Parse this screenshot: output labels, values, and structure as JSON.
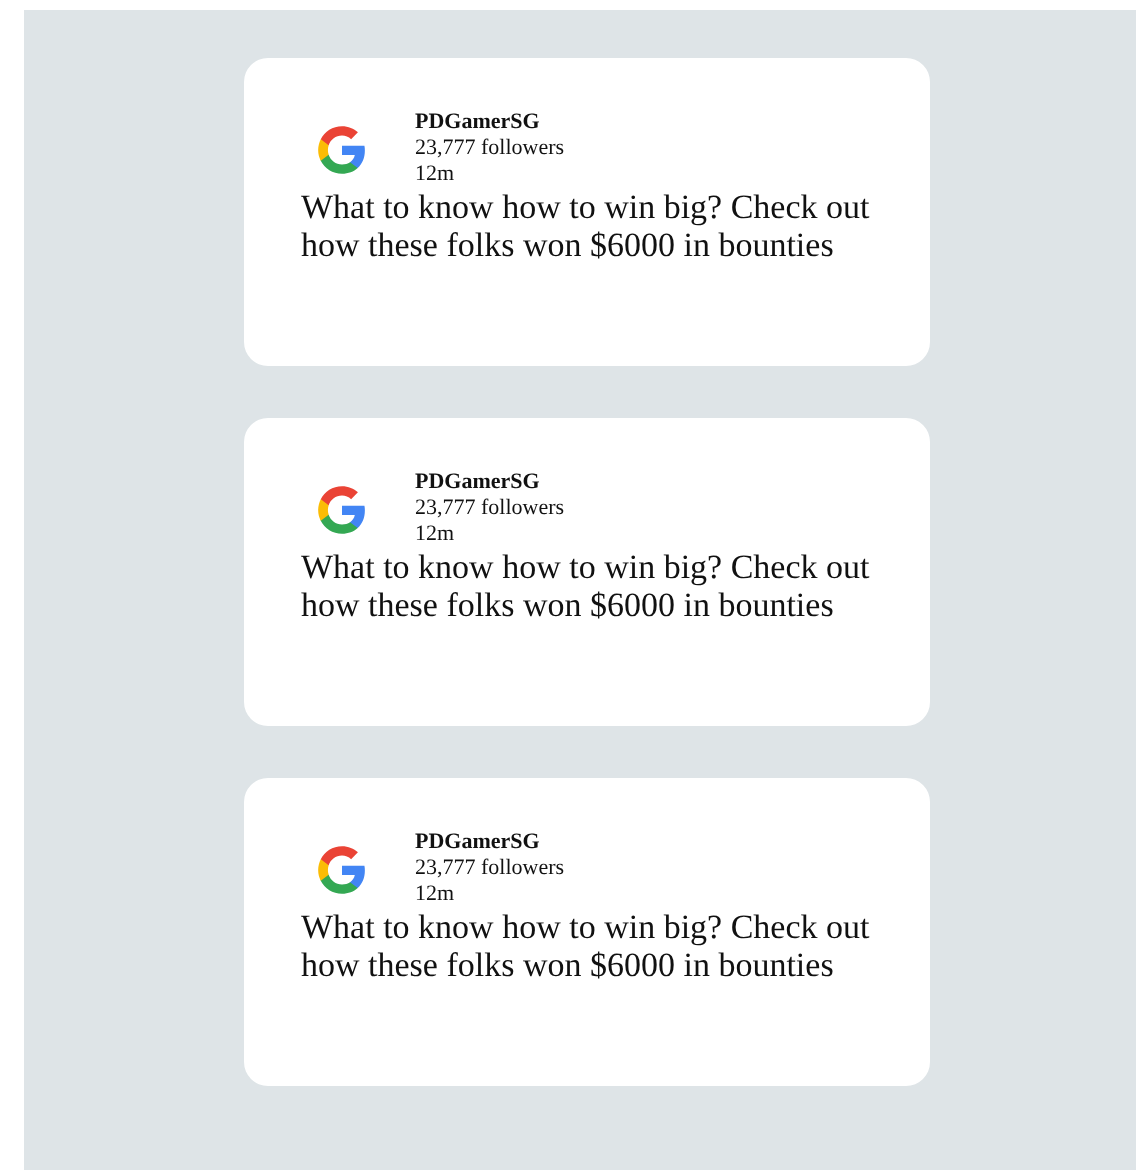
{
  "posts": [
    {
      "author": "PDGamerSG",
      "followers": "23,777 followers",
      "time": "12m",
      "text": "What to know how to win big? Check out how these folks won $6000 in bounties"
    },
    {
      "author": "PDGamerSG",
      "followers": "23,777 followers",
      "time": "12m",
      "text": "What to know how to win big? Check out how these folks won $6000 in bounties"
    },
    {
      "author": "PDGamerSG",
      "followers": "23,777 followers",
      "time": "12m",
      "text": "What to know how to win big? Check out how these folks won $6000 in bounties"
    }
  ]
}
